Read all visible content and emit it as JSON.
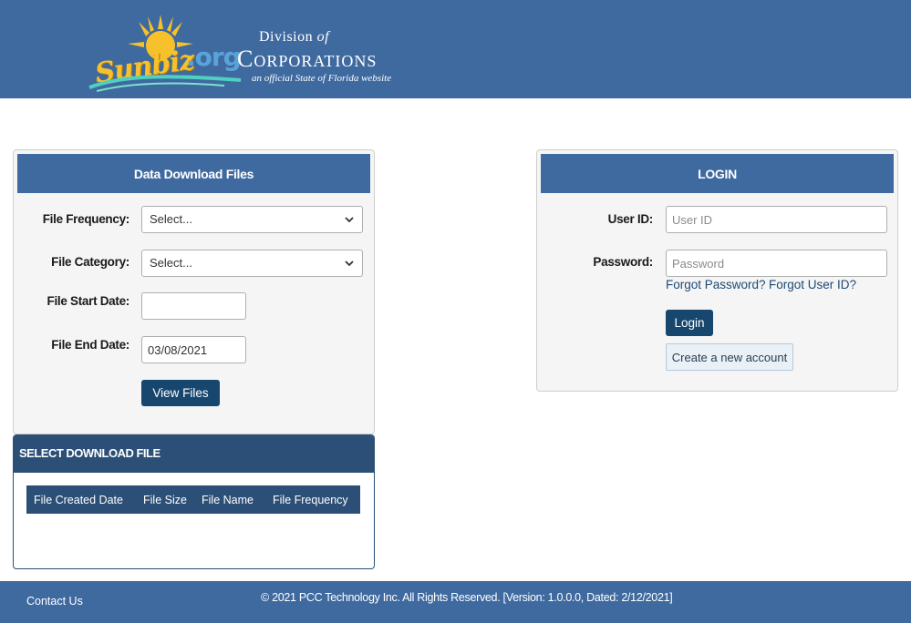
{
  "header": {
    "logo_sunbiz": "Sunbiz",
    "logo_org": ".org",
    "division": "Division",
    "division_of": "of",
    "corporations": "Corporations",
    "tagline": "an official State of Florida website",
    "colors": {
      "bar": "#3f6aa0",
      "sun": "#f6c12a",
      "org": "#5aa3d8"
    }
  },
  "download": {
    "title": "Data Download Files",
    "file_frequency_label": "File Frequency:",
    "file_frequency_value": "Select...",
    "file_category_label": "File Category:",
    "file_category_value": "Select...",
    "start_date_label": "File Start Date:",
    "start_date_value": "",
    "end_date_label": "File End Date:",
    "end_date_value": "03/08/2021",
    "view_button": "View Files"
  },
  "select_download": {
    "title": "SELECT DOWNLOAD FILE",
    "columns": [
      "File Created Date",
      "File Size",
      "File Name",
      "File Frequency"
    ]
  },
  "login": {
    "title": "LOGIN",
    "user_id_label": "User ID:",
    "user_id_placeholder": "User ID",
    "password_label": "Password:",
    "password_placeholder": "Password",
    "forgot_password": "Forgot Password?",
    "forgot_user_id": "Forgot User ID?",
    "login_button": "Login",
    "create_account_button": "Create a new account"
  },
  "footer": {
    "contact": "Contact Us",
    "copyright": "© 2021 PCC Technology Inc. All Rights Reserved. [Version: 1.0.0.0, Dated: 2/12/2021]"
  },
  "icons": [
    "sun-icon",
    "swoosh-icon",
    "chevron-down-icon"
  ]
}
